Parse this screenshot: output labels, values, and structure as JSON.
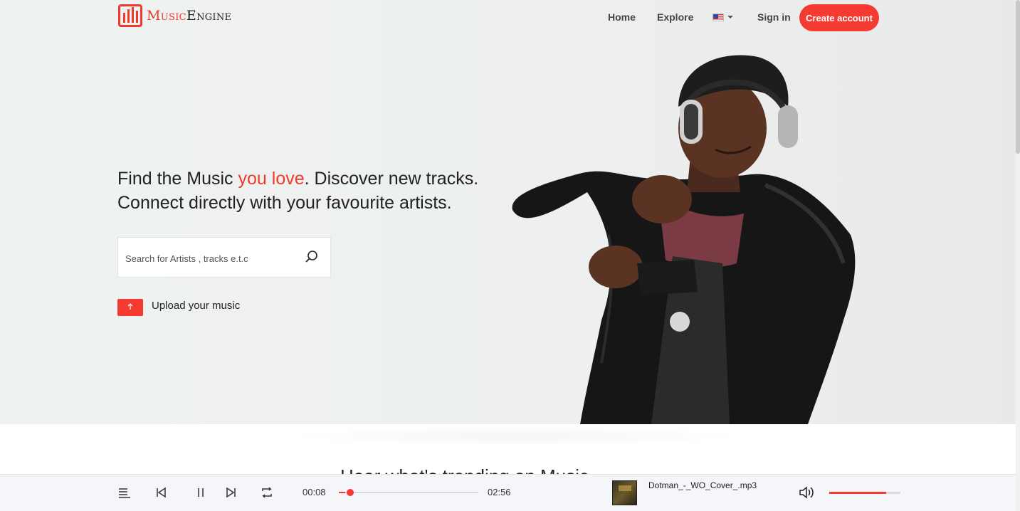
{
  "brand": {
    "name_part1": "Music",
    "name_part2": "Engine",
    "accent": "#f03a2c"
  },
  "nav": {
    "home": "Home",
    "explore": "Explore",
    "language_icon": "us-flag-icon",
    "sign_in": "Sign in",
    "create_account": "Create account"
  },
  "hero": {
    "headline_1a": "Find the Music ",
    "headline_1b": "you love",
    "headline_1c": ". Discover new tracks.",
    "headline_2": "Connect directly with your favourite artists.",
    "search_placeholder": "Search for Artists , tracks e.t.c",
    "upload_label": "Upload your music"
  },
  "section": {
    "partial_heading": "Hear what's trending on Music"
  },
  "player": {
    "current_time": "00:08",
    "duration": "02:56",
    "progress_fraction": 0.045,
    "track_name": "Dotman_-_WO_Cover_.mp3",
    "volume_fraction": 0.8
  },
  "colors": {
    "accent": "#f53b31",
    "hero_bg": "#eef2f1",
    "player_bg": "#f4f6f9"
  }
}
